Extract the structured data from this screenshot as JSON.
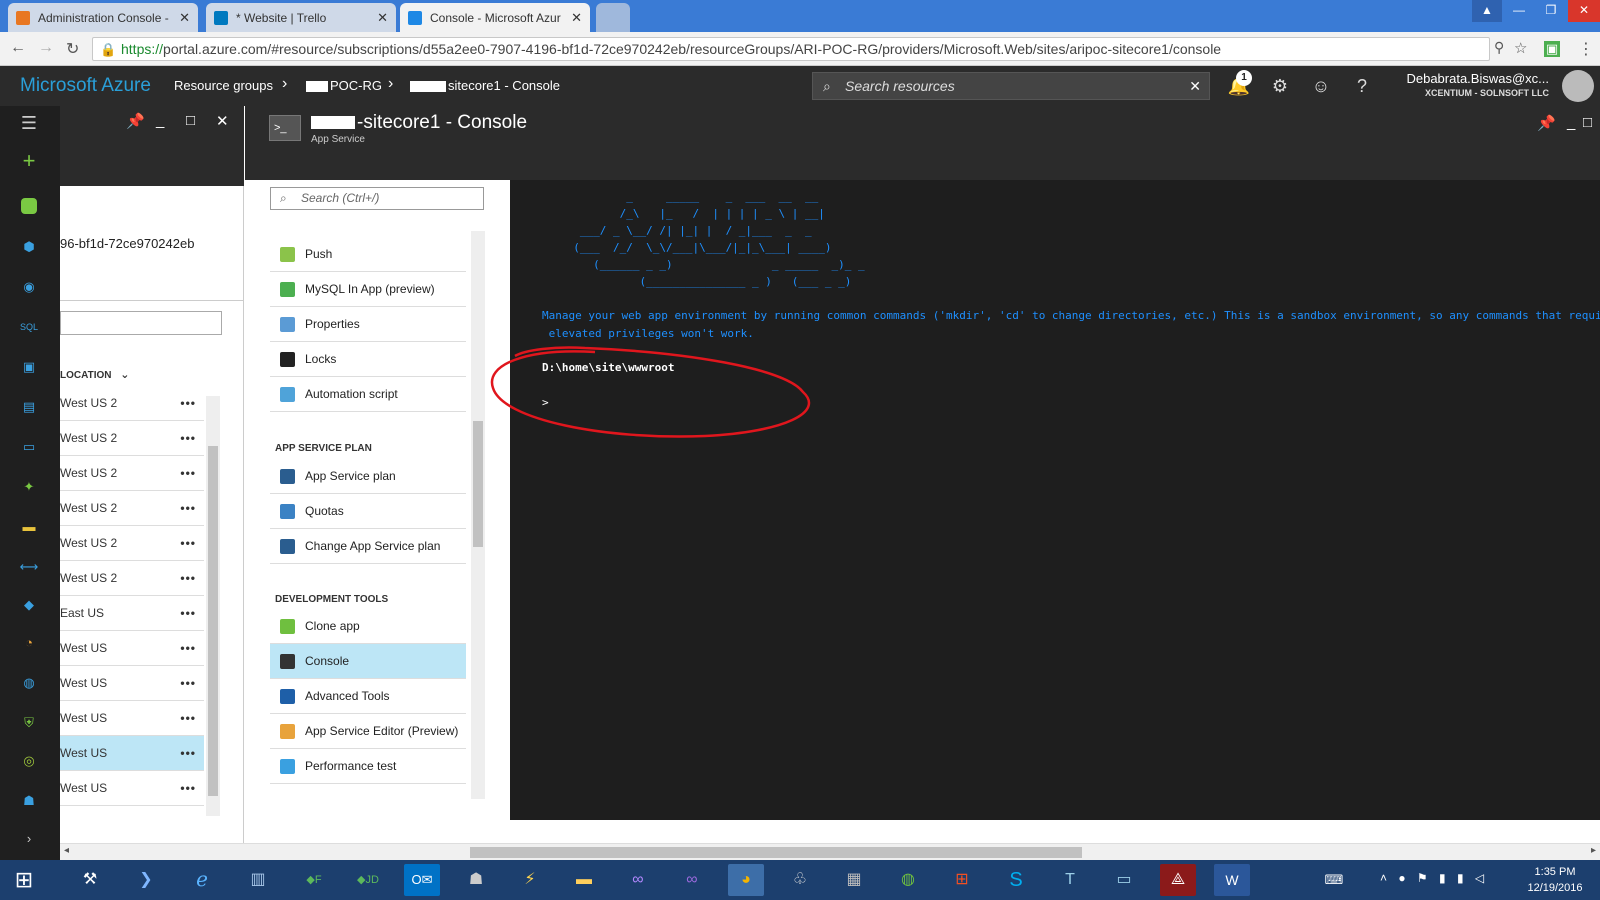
{
  "browser": {
    "tabs": [
      {
        "title": "Administration Console -",
        "color": "#e87722"
      },
      {
        "title": "* Website | Trello",
        "color": "#0079bf"
      },
      {
        "title": "Console - Microsoft Azur",
        "color": "#1e88e5"
      }
    ],
    "url_scheme": "https://",
    "url_rest": "portal.azure.com/#resource/subscriptions/d55a2ee0-7907-4196-bf1d-72ce970242eb/resourceGroups/ARI-POC-RG/providers/Microsoft.Web/sites/aripoc-sitecore1/console"
  },
  "azure_header": {
    "brand": "Microsoft Azure",
    "breadcrumb": [
      "Resource groups",
      "POC-RG",
      "sitecore1 - Console"
    ],
    "search_placeholder": "Search resources",
    "notification_count": "1",
    "user_name": "Debabrata.Biswas@xc...",
    "user_org": "XCENTIUM - SOLNSOFT LLC"
  },
  "blade1": {
    "subscription_fragment": "96-bf1d-72ce970242eb",
    "location_header": "LOCATION",
    "locations": [
      "West US 2",
      "West US 2",
      "West US 2",
      "West US 2",
      "West US 2",
      "West US 2",
      "East US",
      "West US",
      "West US",
      "West US",
      "West US",
      "West US"
    ],
    "selected_index": 10
  },
  "blade2": {
    "title": "-sitecore1 - Console",
    "subtitle": "App Service",
    "search_placeholder": "Search (Ctrl+/)",
    "menu_top": [
      {
        "label": "Push",
        "color": "#8bc34a"
      },
      {
        "label": "MySQL In App (preview)",
        "color": "#4caf50"
      },
      {
        "label": "Properties",
        "color": "#5b9bd5"
      },
      {
        "label": "Locks",
        "color": "#222222"
      },
      {
        "label": "Automation script",
        "color": "#4fa3d9"
      }
    ],
    "section_plan": "APP SERVICE PLAN",
    "menu_plan": [
      {
        "label": "App Service plan",
        "color": "#2a5d8f"
      },
      {
        "label": "Quotas",
        "color": "#3b82c4"
      },
      {
        "label": "Change App Service plan",
        "color": "#2a5d8f"
      }
    ],
    "section_dev": "DEVELOPMENT TOOLS",
    "menu_dev": [
      {
        "label": "Clone app",
        "color": "#6fbf3f"
      },
      {
        "label": "Console",
        "color": "#333333"
      },
      {
        "label": "Advanced Tools",
        "color": "#1e5fa8"
      },
      {
        "label": "App Service Editor (Preview)",
        "color": "#e8a33c"
      },
      {
        "label": "Performance test",
        "color": "#3aa0e0"
      }
    ],
    "selected_dev_index": 1
  },
  "console": {
    "ascii_art": "          _     _____    _  ___  __  __\n         /_\\   |_   /  | | | | _ \\ | __|\n   ___/ _ \\__/ /| |_| |  / _|___  _  _\n  (___  /_/  \\_\\/___|\\___/|_|_\\___| ____)\n     (______ _ _)               _ _____  _)_ _\n            (_______________ _ )   (___ _ _)",
    "message": "Manage your web app environment by running common commands ('mkdir', 'cd' to change directories, etc.) This is a sandbox environment, so any commands that requi\n elevated privileges won't work.",
    "cwd": "D:\\home\\site\\wwwroot",
    "prompt": ">"
  },
  "taskbar": {
    "time": "1:35 PM",
    "date": "12/19/2016"
  }
}
